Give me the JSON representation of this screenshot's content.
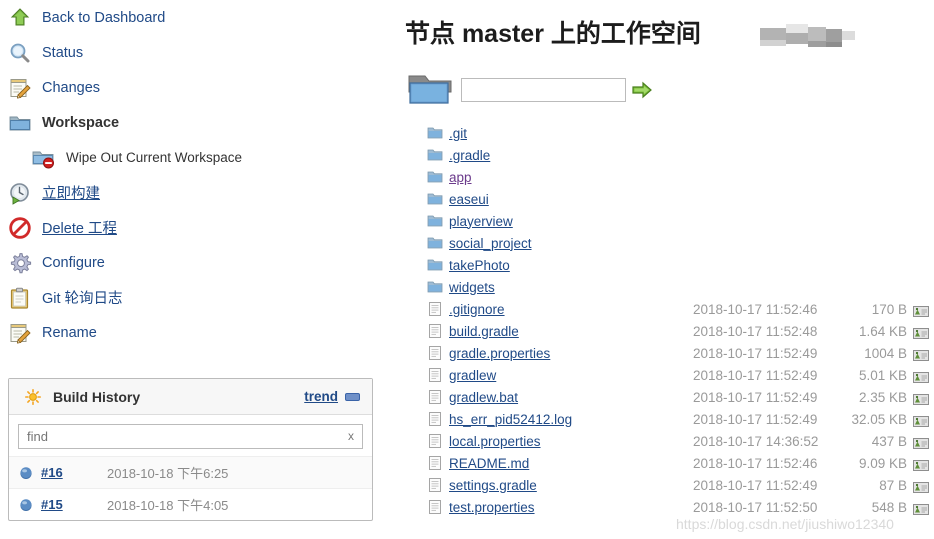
{
  "sidebar": {
    "tasks": [
      {
        "label": "Back to Dashboard",
        "icon": "up-arrow-icon",
        "style": "plain"
      },
      {
        "label": "Status",
        "icon": "magnifier-icon",
        "style": "plain"
      },
      {
        "label": "Changes",
        "icon": "notepad-pencil-icon",
        "style": "plain"
      },
      {
        "label": "Workspace",
        "icon": "folder-icon",
        "style": "bold"
      },
      {
        "label": "Wipe Out Current Workspace",
        "icon": "folder-delete-icon",
        "style": "sub"
      },
      {
        "label": "立即构建",
        "icon": "build-now-icon",
        "style": "link"
      },
      {
        "label": "Delete 工程",
        "icon": "delete-icon",
        "style": "link"
      },
      {
        "label": "Configure",
        "icon": "gear-icon",
        "style": "plain"
      },
      {
        "label": "Git 轮询日志",
        "icon": "clipboard-icon",
        "style": "plain"
      },
      {
        "label": "Rename",
        "icon": "notepad-pencil-icon",
        "style": "plain"
      }
    ],
    "build_history": {
      "title": "Build History",
      "trend_label": "trend",
      "find_placeholder": "find",
      "find_value": "",
      "clear_label": "x",
      "builds": [
        {
          "number": "#16",
          "timestamp": "2018-10-18 下午6:25",
          "status": "blue"
        },
        {
          "number": "#15",
          "timestamp": "2018-10-18 下午4:05",
          "status": "blue"
        }
      ]
    }
  },
  "main": {
    "title": "节点 master 上的工作空间",
    "title_redacted": true,
    "path_input_value": "",
    "path_input_placeholder": "",
    "go_label": "",
    "directories": [
      {
        "name": ".git",
        "visited": false
      },
      {
        "name": ".gradle",
        "visited": false
      },
      {
        "name": "app",
        "visited": true
      },
      {
        "name": "easeui",
        "visited": false
      },
      {
        "name": "playerview",
        "visited": false
      },
      {
        "name": "social_project",
        "visited": false
      },
      {
        "name": "takePhoto",
        "visited": false
      },
      {
        "name": "widgets",
        "visited": false
      }
    ],
    "view_label": "view",
    "files": [
      {
        "name": ".gitignore",
        "date": "2018-10-17 11:52:46",
        "size": "170 B"
      },
      {
        "name": "build.gradle",
        "date": "2018-10-17 11:52:48",
        "size": "1.64 KB"
      },
      {
        "name": "gradle.properties",
        "date": "2018-10-17 11:52:49",
        "size": "1004 B"
      },
      {
        "name": "gradlew",
        "date": "2018-10-17 11:52:49",
        "size": "5.01 KB"
      },
      {
        "name": "gradlew.bat",
        "date": "2018-10-17 11:52:49",
        "size": "2.35 KB"
      },
      {
        "name": "hs_err_pid52412.log",
        "date": "2018-10-17 11:52:49",
        "size": "32.05 KB"
      },
      {
        "name": "local.properties",
        "date": "2018-10-17 14:36:52",
        "size": "437 B"
      },
      {
        "name": "README.md",
        "date": "2018-10-17 11:52:46",
        "size": "9.09 KB"
      },
      {
        "name": "settings.gradle",
        "date": "2018-10-17 11:52:49",
        "size": "87 B"
      },
      {
        "name": "test.properties",
        "date": "2018-10-17 11:52:50",
        "size": "548 B"
      }
    ]
  },
  "watermark": "https://blog.csdn.net/jiushiwo12340",
  "colors": {
    "link": "#204a87",
    "visited_link": "#6b3a8b",
    "muted_text": "#9a9a9a",
    "accent_green": "#5aa02c",
    "status_blue": "#4f7ab5",
    "sun_orange": "#f5a623"
  }
}
